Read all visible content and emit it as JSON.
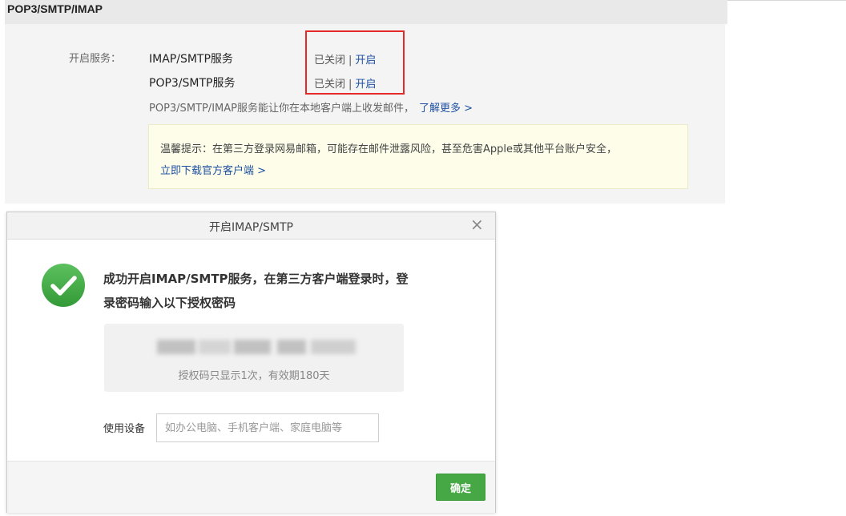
{
  "section": {
    "title": "POP3/SMTP/IMAP",
    "service_label": "开启服务：",
    "services": [
      {
        "name": "IMAP/SMTP服务",
        "status": "已关闭",
        "separator": "|",
        "action": "开启"
      },
      {
        "name": "POP3/SMTP服务",
        "status": "已关闭",
        "separator": "|",
        "action": "开启"
      }
    ],
    "hint": "POP3/SMTP/IMAP服务能让你在本地客户端上收发邮件，",
    "learn_more": "了解更多 >",
    "tip": {
      "text": "温馨提示：在第三方登录网易邮箱，可能存在邮件泄露风险，甚至危害Apple或其他平台账户安全，",
      "link": "立即下载官方客户端 >"
    }
  },
  "dialog": {
    "title": "开启IMAP/SMTP",
    "close_icon": "close-icon",
    "success_icon": "check-circle-icon",
    "success_message": "成功开启IMAP/SMTP服务，在第三方客户端登录时，登录密码输入以下授权密码",
    "code_note": "授权码只显示1次，有效期180天",
    "device_label": "使用设备",
    "device_placeholder": "如办公电脑、手机客户端、家庭电脑等",
    "confirm_label": "确定"
  },
  "colors": {
    "link": "#1e50a2",
    "highlight_border": "#e52a2a",
    "success_green": "#3fa843",
    "button_green": "#45a845",
    "tip_background": "#fdfde9"
  }
}
